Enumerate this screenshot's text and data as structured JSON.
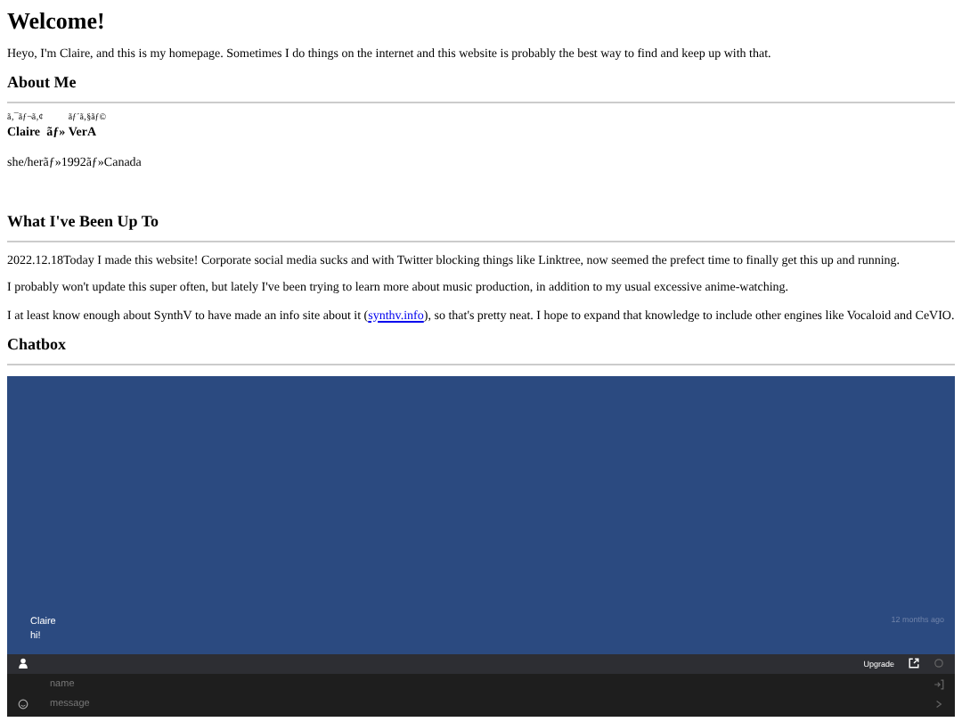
{
  "title": "Welcome!",
  "intro": "Heyo, I'm Claire, and this is my homepage. Sometimes I do things on the internet and this website is probably the best way to find and keep up with that.",
  "about": {
    "heading": "About Me",
    "name_parts": [
      {
        "text": "Claire",
        "ruby": "ã‚¯ãƒ¬ã‚¢"
      },
      {
        "text": " ãƒ» "
      },
      {
        "text": "VerA",
        "ruby": "ãƒ´ã‚§ãƒ©"
      }
    ],
    "details": "she/herãƒ»1992ãƒ»Canada"
  },
  "updates": {
    "heading": "What I've Been Up To",
    "paragraphs": [
      {
        "text": "2022.12.18Today I made this website! Corporate social media sucks and with Twitter blocking things like Linktree, now seemed the prefect time to finally get this up and running."
      },
      {
        "text": "I probably won't update this super often, but lately I've been trying to learn more about music production, in addition to my usual excessive anime-watching."
      },
      {
        "text": "I at least know enough about SynthV to have made an info site about it (",
        "link": "synthv.info",
        "after": "), so that's pretty neat. I hope to expand that knowledge to include other engines like Vocaloid and CeVIO."
      }
    ]
  },
  "chatbox": {
    "heading": "Chatbox",
    "messages": [
      {
        "author": "Claire",
        "text": "hi!",
        "time": "12 months ago"
      }
    ],
    "upgrade": "Upgrade",
    "name_placeholder": "name",
    "message_placeholder": "message"
  }
}
